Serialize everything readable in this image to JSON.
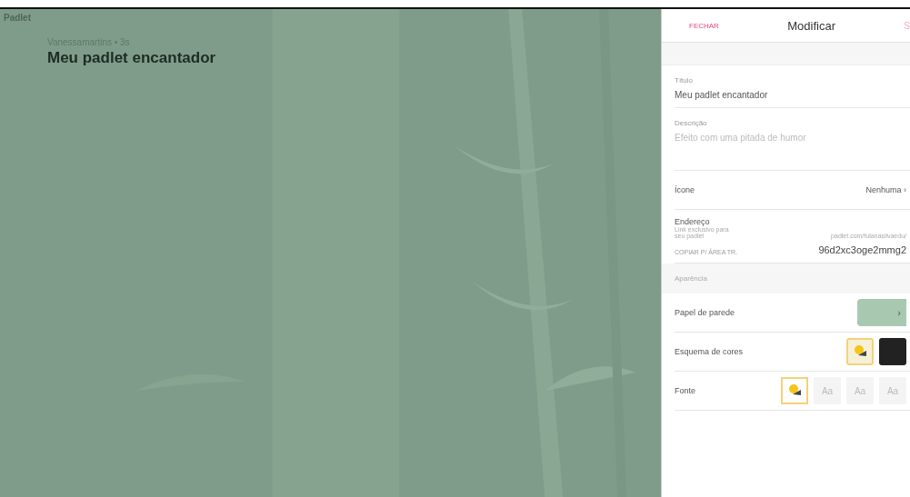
{
  "wall": {
    "brand": "Padlet",
    "subtitle": "Vanessamartins • 3s",
    "title": "Meu padlet encantador"
  },
  "panel": {
    "close": "FECHAR",
    "title": "Modificar",
    "save": "S",
    "title_field": {
      "label": "Título",
      "value": "Meu padlet encantador"
    },
    "description_field": {
      "label": "Descrição",
      "placeholder": "Efeito com uma pitada de humor"
    },
    "icon_row": {
      "label": "Ícone",
      "value": "Nenhuma",
      "chevron": "›"
    },
    "address": {
      "label": "Endereço",
      "hint": "Link exclusivo para seu padlet",
      "prefix": "padlet.com/fulanasilvaedu/",
      "copy": "COPIAR P/ ÁREA TR.",
      "slug": "96d2xc3oge2mmg2"
    },
    "section": "Aparência",
    "wallpaper": {
      "label": "Papel de parede",
      "chevron": "›"
    },
    "color_scheme": {
      "label": "Esquema de cores",
      "options": [
        {
          "kind": "light",
          "selected": true
        },
        {
          "kind": "dark",
          "selected": false
        }
      ]
    },
    "font": {
      "label": "Fonte",
      "options": [
        {
          "kind": "icon",
          "selected": true
        },
        {
          "kind": "text",
          "text": "Aa",
          "selected": false
        },
        {
          "kind": "text",
          "text": "Aa",
          "selected": false
        },
        {
          "kind": "text",
          "text": "Aa",
          "selected": false
        }
      ]
    }
  }
}
